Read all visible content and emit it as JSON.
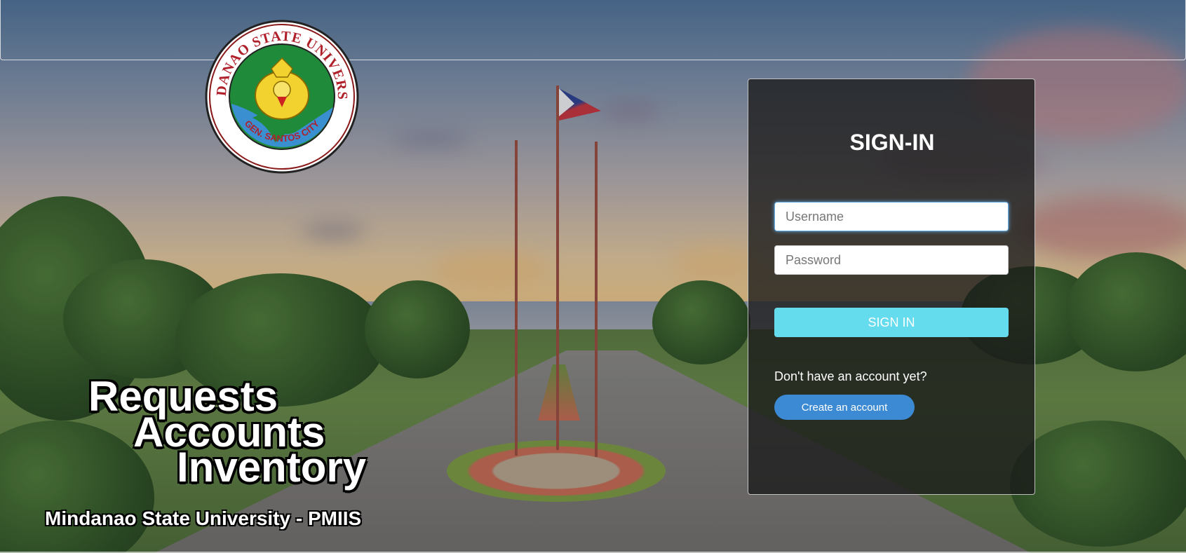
{
  "branding": {
    "logo_ring_text": "MINDANAO STATE UNIVERSITY",
    "logo_bottom_text": "GEN. SANTOS CITY"
  },
  "headline": {
    "line1": "Requests",
    "line2": "Accounts",
    "line3": "Inventory",
    "subtitle": "Mindanao State University - PMIIS"
  },
  "signin": {
    "title": "SIGN-IN",
    "username_placeholder": "Username",
    "password_placeholder": "Password",
    "submit_label": "SIGN IN",
    "no_account_text": "Don't have an account yet?",
    "create_account_label": "Create an account"
  },
  "colors": {
    "signin_button": "#65dced",
    "create_button": "#3b8ad3",
    "panel_bg": "rgba(25,25,25,0.78)"
  }
}
